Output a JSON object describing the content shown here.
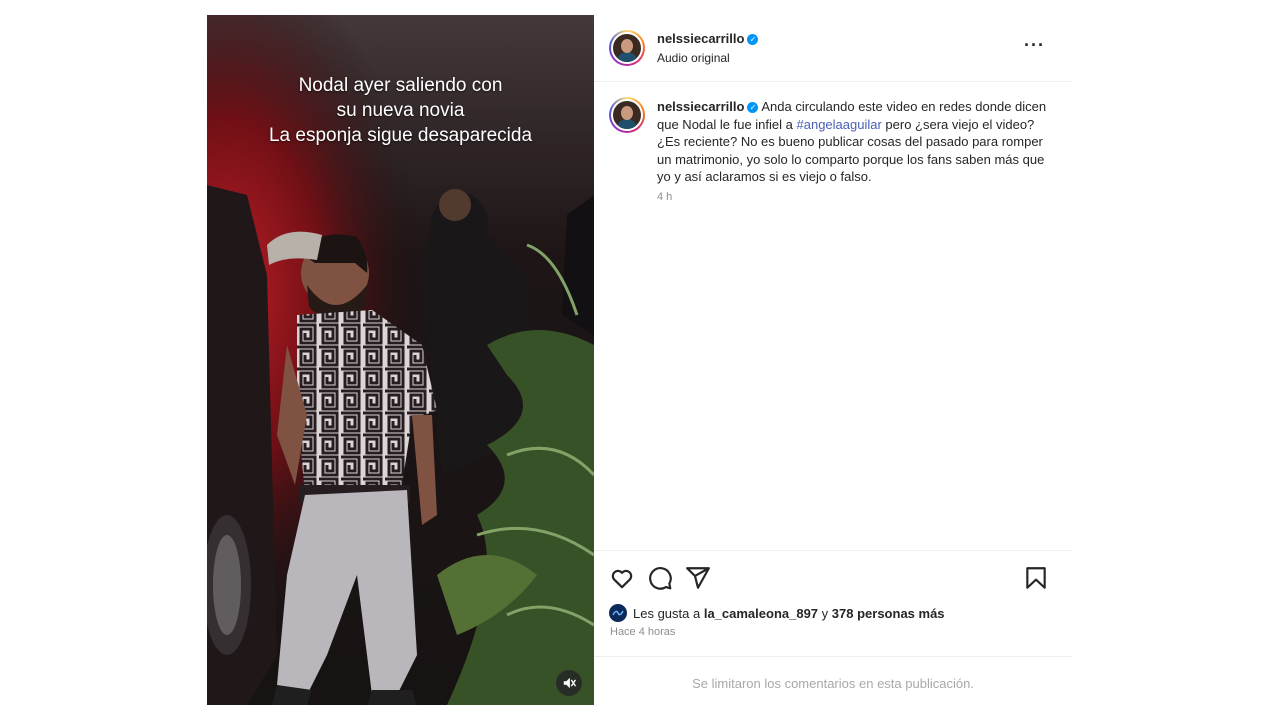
{
  "media": {
    "overlay_lines": [
      "Nodal ayer saliendo con",
      "su nueva novia",
      "La esponja sigue desaparecida"
    ],
    "mute_icon": "speaker-muted-icon"
  },
  "header": {
    "username": "nelssiecarrillo",
    "subtitle": "Audio original",
    "more_icon": "more-options-icon"
  },
  "caption": {
    "username": "nelssiecarrillo",
    "text_before": "Anda circulando este video en redes donde dicen que Nodal le fue infiel a",
    "hashtag": "#angelaaguilar",
    "text_after": "pero ¿sera viejo el video? ¿Es reciente? No es bueno publicar cosas del pasado para romper un matrimonio, yo solo lo comparto porque los fans saben más que yo y así aclaramos si es viejo o falso.",
    "time": "4 h"
  },
  "actions": [
    "heart-icon",
    "comment-icon",
    "share-icon",
    "bookmark-icon"
  ],
  "likes": {
    "prefix": "Les gusta a",
    "liker": "la_camaleona_897",
    "joiner": "y",
    "others": "378 personas más"
  },
  "posted_ago": "Hace 4 horas",
  "comments_limited": "Se limitaron los comentarios en esta publicación.",
  "colors": {
    "link": "#4a5fb5",
    "verified": "#0095f6",
    "muted_text": "#8e8e8e"
  }
}
